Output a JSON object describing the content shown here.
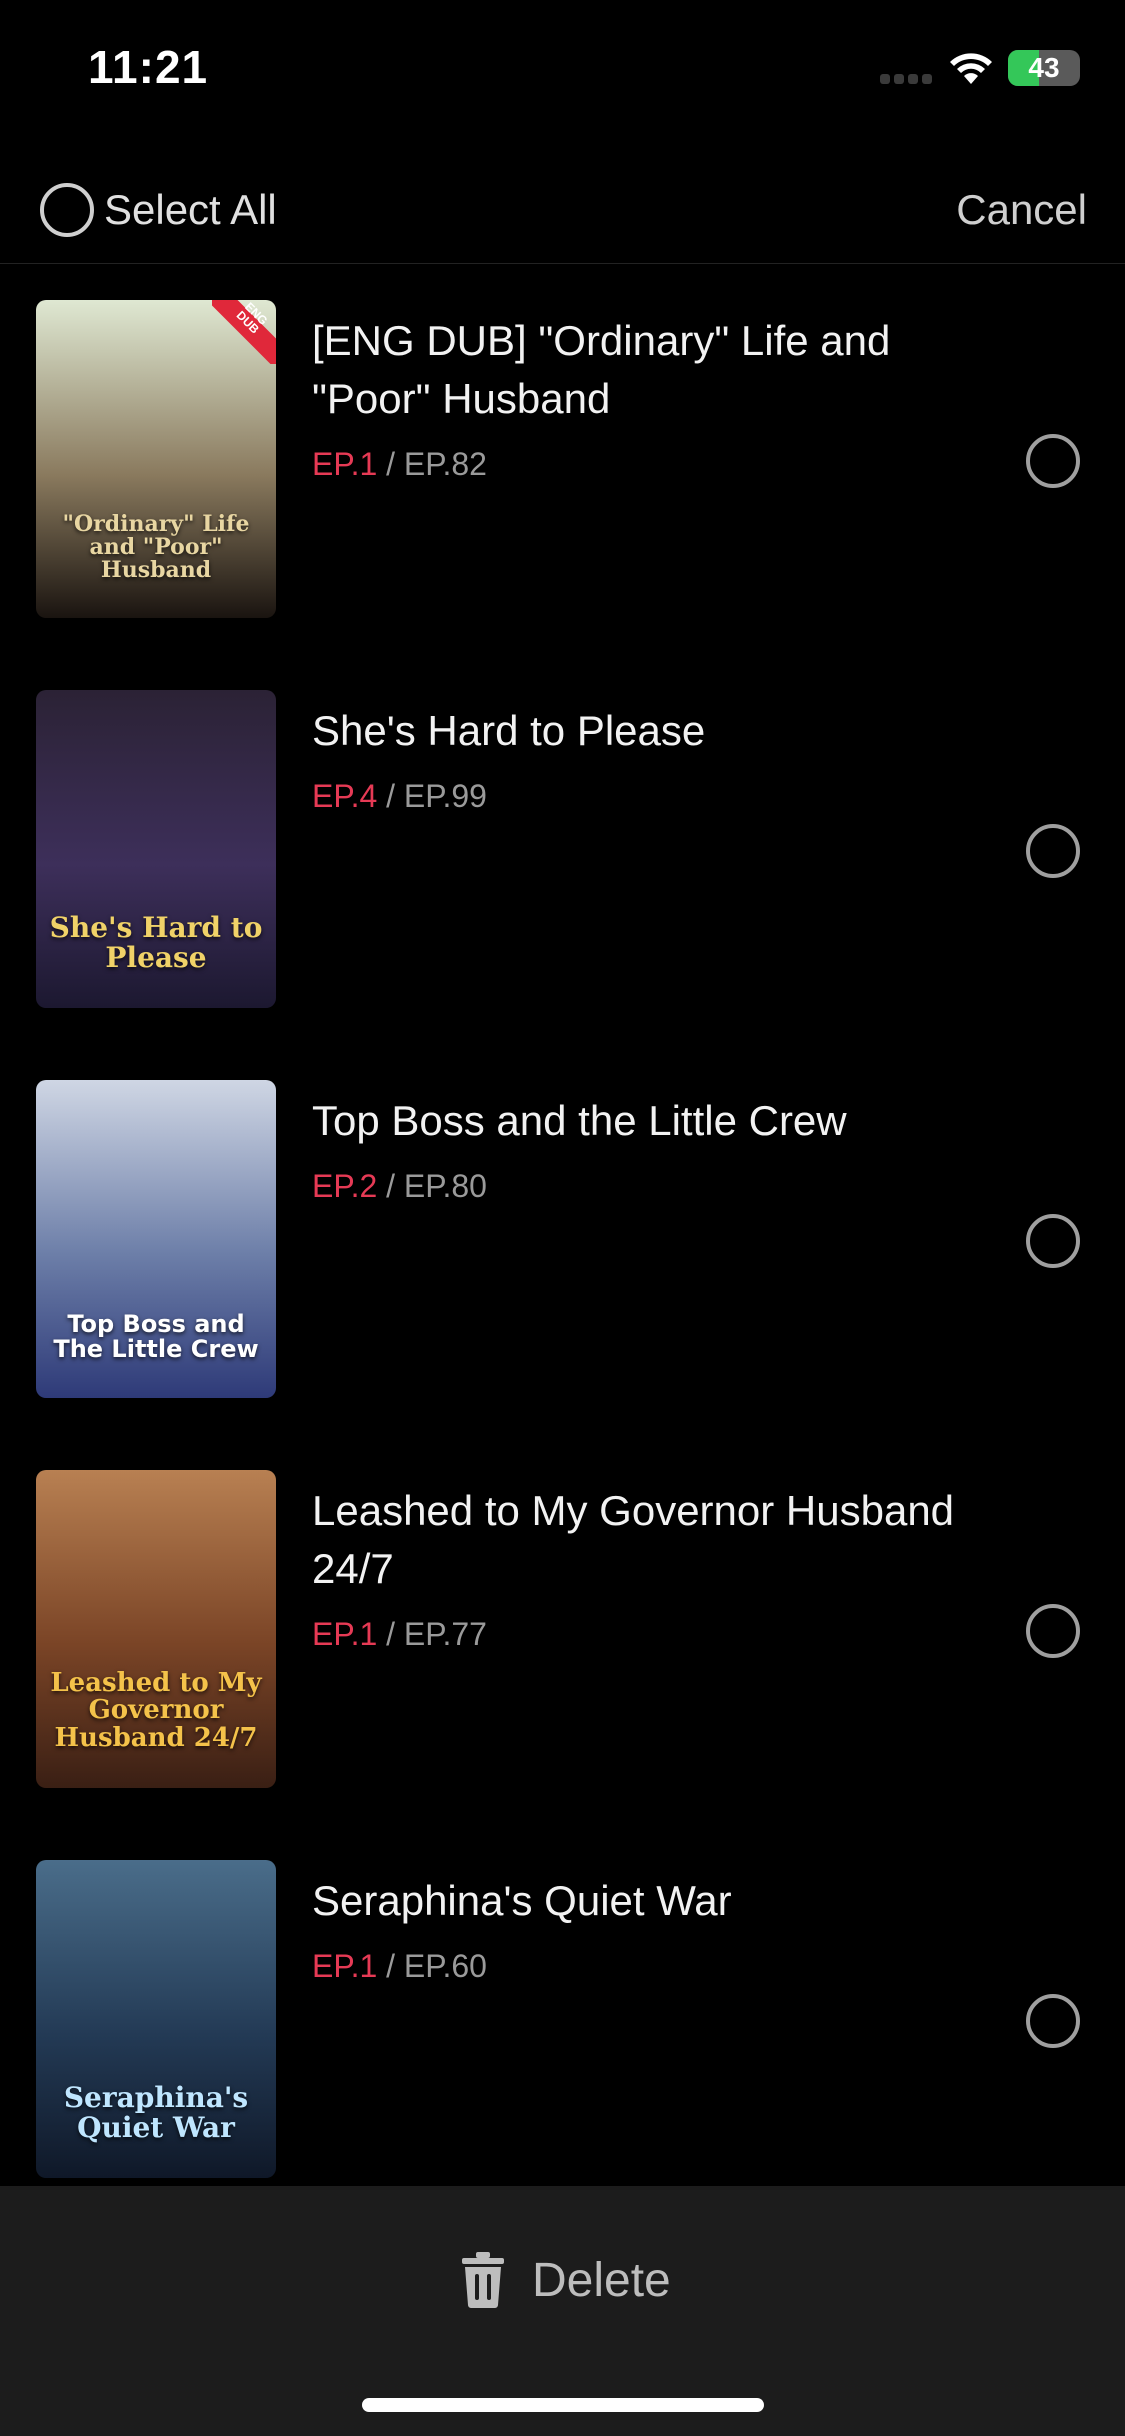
{
  "status_bar": {
    "time": "11:21",
    "battery": "43",
    "battery_level": 0.43
  },
  "header": {
    "select_all": "Select All",
    "cancel": "Cancel"
  },
  "items": [
    {
      "title": "[ENG DUB] \"Ordinary\" Life and \"Poor\" Husband",
      "ep_current": "EP.1",
      "ep_total": "EP.82",
      "poster_text": "\"Ordinary\" Life and \"Poor\" Husband",
      "badge": "ENG DUB",
      "poster_colors": [
        "#dfe8d2",
        "#8a7a5e",
        "#1a1410"
      ],
      "text_color": "#e8d6a2"
    },
    {
      "title": "She's Hard to Please",
      "ep_current": "EP.4",
      "ep_total": "EP.99",
      "poster_text": "She's Hard to Please",
      "poster_colors": [
        "#2b2235",
        "#3d2f5a",
        "#1c1830"
      ],
      "text_color": "#f0d268"
    },
    {
      "title": "Top Boss and the Little Crew",
      "ep_current": "EP.2",
      "ep_total": "EP.80",
      "poster_text": "Top Boss and The Little Crew",
      "poster_colors": [
        "#cfd6e4",
        "#6c7ea8",
        "#2e3a78"
      ],
      "text_color": "#ffffff"
    },
    {
      "title": "Leashed to My Governor Husband 24/7",
      "ep_current": "EP.1",
      "ep_total": "EP.77",
      "poster_text": "Leashed to My Governor Husband 24/7",
      "poster_colors": [
        "#b88052",
        "#7a4426",
        "#3a1f14"
      ],
      "text_color": "#f4c24a"
    },
    {
      "title": "Seraphina's Quiet War",
      "ep_current": "EP.1",
      "ep_total": "EP.60",
      "poster_text": "Seraphina's Quiet War",
      "poster_colors": [
        "#4a6d8a",
        "#233a55",
        "#0f1828"
      ],
      "text_color": "#bfe6ff"
    }
  ],
  "bottom": {
    "delete": "Delete"
  },
  "colors": {
    "accent": "#e63a55",
    "background": "#000000",
    "bottom_bar": "#1c1c1c"
  }
}
